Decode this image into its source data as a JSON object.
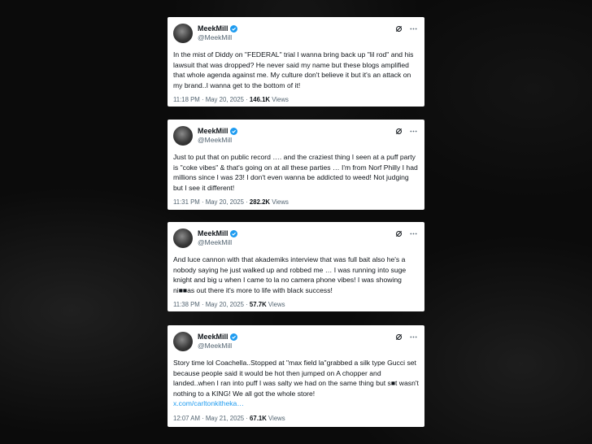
{
  "tweets": [
    {
      "name": "MeekMill",
      "handle": "@MeekMill",
      "text": "In the mist of Diddy on  \"FEDERAL\" trial I wanna bring back up \"lil rod\" and his lawsuit that was dropped?  He never said my name but these blogs amplified that whole agenda against me. My culture don't believe it but it's an attack on my brand..I wanna get to the bottom of it!",
      "link": "",
      "time": "11:18 PM · May 20, 2025 · ",
      "views_count": "146.1K",
      "views_label": " Views"
    },
    {
      "name": "MeekMill",
      "handle": "@MeekMill",
      "text": "Just to put that on public record …. and the craziest thing I seen at a puff party is \"coke vibes\" &  that's going on at all these parties … I'm from Norf Philly I  had  millions since I was 23! I don't even wanna be addicted to weed! Not judging but I see it different!",
      "link": "",
      "time": "11:31 PM · May 20, 2025 · ",
      "views_count": "282.2K",
      "views_label": " Views"
    },
    {
      "name": "MeekMill",
      "handle": "@MeekMill",
      "text": "And luce cannon with that akademiks interview  that was full bait also he's a nobody saying he just walked up and robbed me … I was running into suge knight and big u when I came to la no camera phone vibes! I was showing ni■■as out there it's more to life with black success!",
      "link": "",
      "time": "11:38 PM · May 20, 2025 · ",
      "views_count": "57.7K",
      "views_label": " Views"
    },
    {
      "name": "MeekMill",
      "handle": "@MeekMill",
      "text": "Story time lol Coachella..Stopped at \"max field la\"grabbed a  silk type Gucci set because people  said it would be hot then jumped on A chopper and landed..when I ran into puff I was salty we had on the same thing but s■t wasn't  nothing to a KING! We all got the whole store!",
      "link": "x.com/carltonkitheka…",
      "time": "12:07 AM · May 21, 2025 · ",
      "views_count": "67.1K",
      "views_label": " Views"
    }
  ],
  "colors": {
    "background": "#0b0b0b",
    "card": "#ffffff",
    "text": "#0f1419",
    "muted": "#536471",
    "verified": "#1d9bf0",
    "link": "#1d9bf0"
  },
  "icons": [
    "avatar",
    "verified-badge-icon",
    "grok-icon",
    "more-options-icon"
  ]
}
